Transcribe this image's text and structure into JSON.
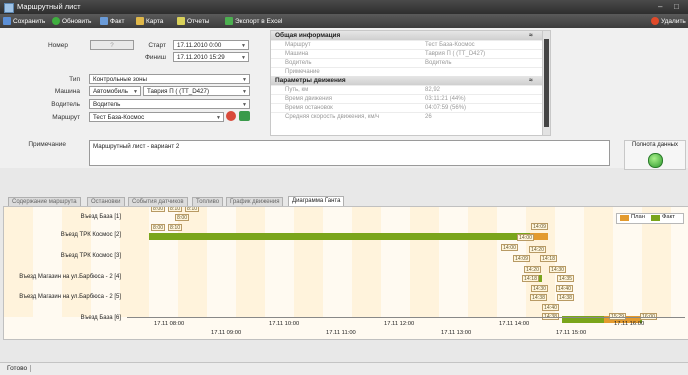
{
  "window": {
    "title": "Маршрутный лист"
  },
  "toolbar": {
    "save": "Сохранить",
    "refresh": "Обновить",
    "fact": "Факт",
    "map": "Карта",
    "reports": "Отчеты",
    "export": "Экспорт в Excel",
    "delete": "Удалить"
  },
  "form": {
    "number_label": "Номер",
    "number_value": "?",
    "start_label": "Старт",
    "start_value": "17.11.2010 0:00",
    "finish_label": "Финиш",
    "finish_value": "17.11.2010 15:29",
    "type_label": "Тип",
    "type_value": "Контрольные зоны",
    "vehicle_label": "Машина",
    "vehicle_kind": "Автомобиль",
    "vehicle_value": "Таврия П ( (TT_D427)",
    "driver_label": "Водитель",
    "driver_value": "Водитель",
    "route_label": "Маршрут",
    "route_value": "Тест База-Космос",
    "note_label": "Примечание",
    "note_value": "Маршрутный лист - вариант 2"
  },
  "info": {
    "general_header": "Общая информация",
    "general_rows": [
      {
        "k": "Маршрут",
        "v": "Тест База-Космос"
      },
      {
        "k": "Машина",
        "v": "Таврия П ( (TT_D427)"
      },
      {
        "k": "Водитель",
        "v": "Водитель"
      },
      {
        "k": "Примечание",
        "v": ""
      }
    ],
    "motion_header": "Параметры движения",
    "motion_rows": [
      {
        "k": "Путь, км",
        "v": "82,92"
      },
      {
        "k": "Время движения",
        "v": "03:11:21 (44%)"
      },
      {
        "k": "Время остановок",
        "v": "04:07:59 (56%)"
      },
      {
        "k": "Средняя скорость движения, км/ч",
        "v": "26"
      }
    ]
  },
  "data_completeness": {
    "label": "Полнота данных"
  },
  "tabs": [
    "Содержание маршрута",
    "Остановки",
    "События датчиков",
    "Топливо",
    "График движения",
    "Диаграмма Ганта"
  ],
  "gantt": {
    "legend_plan": "План",
    "legend_fact": "Факт",
    "rows": [
      "Въезд База [1]",
      "Въезд ТРК Космос [2]",
      "Въезд ТРК Космос [3]",
      "Въезд Магазин на ул.Барбюса - 2 [4]",
      "Въезд Магазин на ул.Барбюса - 2 [5]",
      "Въезд База [6]"
    ],
    "ticks_top": [
      "17.11 08:00",
      "17.11 10:00",
      "17.11 12:00",
      "17.11 14:00",
      "17.11 16:00"
    ],
    "ticks_bottom": [
      "17.11 09:00",
      "17.11 11:00",
      "17.11 13:00",
      "17.11 15:00"
    ],
    "tags": [
      "8:00",
      "8:10",
      "8:10",
      "8:00",
      "8:00",
      "8:10",
      "14:00",
      "14:09",
      "14:00",
      "14:20",
      "14:09",
      "14:18",
      "14:20",
      "14:30",
      "14:18",
      "14:35",
      "14:30",
      "14:40",
      "14:38",
      "14:38",
      "14:40",
      "14:38",
      "15:29",
      "16:00"
    ]
  },
  "status": {
    "text": "Готово"
  },
  "colors": {
    "plan": "#e39a2e",
    "fact": "#7aa51b"
  }
}
